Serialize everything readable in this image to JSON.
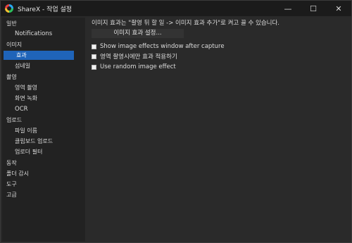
{
  "window": {
    "title": "ShareX - 작업 설정",
    "controls": {
      "minimize": "—",
      "maximize": "☐",
      "close": "✕"
    }
  },
  "sidebar": {
    "items": [
      {
        "label": "일반"
      },
      {
        "label": "Notifications"
      },
      {
        "label": "이미지"
      },
      {
        "label": "효과",
        "selected": true
      },
      {
        "label": "섬네일"
      },
      {
        "label": "촬영"
      },
      {
        "label": "영역 촬영"
      },
      {
        "label": "화면 녹화"
      },
      {
        "label": "OCR"
      },
      {
        "label": "업로드"
      },
      {
        "label": "파일 이름"
      },
      {
        "label": "클립보드 업로드"
      },
      {
        "label": "업로더 필터"
      },
      {
        "label": "동작"
      },
      {
        "label": "폴더 감시"
      },
      {
        "label": "도구"
      },
      {
        "label": "고급"
      }
    ]
  },
  "content": {
    "hint": "이미지 효과는 \"촬영 뒤 할 일 -> 이미지 효과 추가\"로 켜고 끌 수 있습니다.",
    "effect_button": "이미지 효과 설정...",
    "checkboxes": [
      {
        "label": "Show image effects window after capture",
        "checked": false
      },
      {
        "label": "영역 촬영시에만 효과 적용하기",
        "checked": false
      },
      {
        "label": "Use random image effect",
        "checked": false
      }
    ]
  },
  "colors": {
    "accent": "#1f64b9",
    "background": "#2a2a2a",
    "sidebar": "#222222",
    "titlebar": "#1b1b1b"
  }
}
